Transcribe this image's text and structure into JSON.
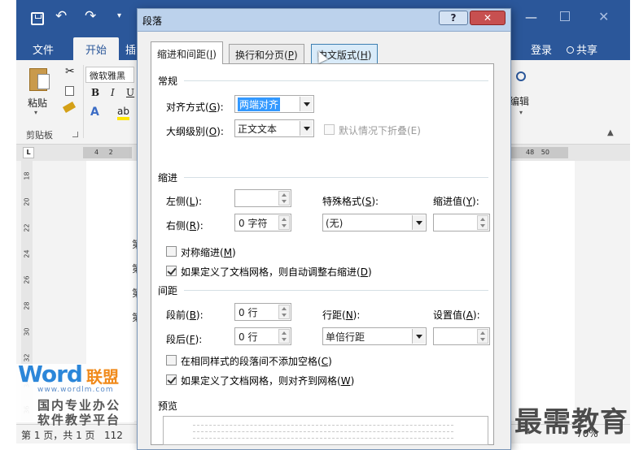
{
  "word": {
    "tabs": {
      "file": "文件",
      "home": "开始",
      "insert_partial": "插"
    },
    "account": {
      "login": "登录",
      "share": "共享"
    },
    "ribbon": {
      "paste_label": "粘贴",
      "clipboard_label": "剪贴板",
      "font_name": "微软雅黑",
      "bold": "B",
      "italic": "I",
      "underline": "U",
      "effects": "A",
      "highlight": "ab",
      "edit_label": "编辑"
    },
    "ruler": {
      "left_ticks": "4 2",
      "right_ticks": "48 50"
    },
    "vruler_ticks": [
      "18",
      "20",
      "22",
      "24",
      "26",
      "28",
      "30",
      "32",
      "34",
      "36"
    ],
    "doc_marks": [
      "第",
      "第",
      "第",
      "第"
    ],
    "status": {
      "page": "第 1 页，共 1 页",
      "page_extra": "112",
      "zoom": "70%"
    }
  },
  "watermark": {
    "word": "Word",
    "lianmeng": "联盟",
    "url": "www.wordlm.com",
    "line1": "国内专业办公",
    "line2": "软件教学平台",
    "brand": "最需教育"
  },
  "dialog": {
    "title": "段落",
    "help": "?",
    "close": "✕",
    "tabs": {
      "indent": {
        "text": "缩进和间距(",
        "key": "I",
        "end": ")"
      },
      "linebreak": {
        "text": "换行和分页(",
        "key": "P",
        "end": ")"
      },
      "asian": {
        "text": "中文版式(",
        "key": "H",
        "end": ")"
      }
    },
    "general": {
      "title": "常规",
      "alignment_label": {
        "text": "对齐方式(",
        "key": "G",
        "end": "):"
      },
      "alignment_value": "两端对齐",
      "outline_label": {
        "text": "大纲级别(",
        "key": "O",
        "end": "):"
      },
      "outline_value": "正文文本",
      "collapse_label": "默认情况下折叠(E)"
    },
    "indent": {
      "title": "缩进",
      "left_label": {
        "text": "左侧(",
        "key": "L",
        "end": "):"
      },
      "left_value": "",
      "right_label": {
        "text": "右侧(",
        "key": "R",
        "end": "):"
      },
      "right_value": "0 字符",
      "special_label": {
        "text": "特殊格式(",
        "key": "S",
        "end": "):"
      },
      "special_value": "(无)",
      "indent_by_label": {
        "text": "缩进值(",
        "key": "Y",
        "end": "):"
      },
      "indent_by_value": "",
      "mirror_label": {
        "text": "对称缩进(",
        "key": "M",
        "end": ")"
      },
      "mirror_checked": false,
      "auto_adjust_label": {
        "text": "如果定义了文档网格，则自动调整右缩进(",
        "key": "D",
        "end": ")"
      },
      "auto_adjust_checked": true
    },
    "spacing": {
      "title": "间距",
      "before_label": {
        "text": "段前(",
        "key": "B",
        "end": "):"
      },
      "before_value": "0 行",
      "after_label": {
        "text": "段后(",
        "key": "F",
        "end": "):"
      },
      "after_value": "0 行",
      "line_spacing_label": {
        "text": "行距(",
        "key": "N",
        "end": "):"
      },
      "line_spacing_value": "单倍行距",
      "at_label": {
        "text": "设置值(",
        "key": "A",
        "end": "):"
      },
      "at_value": "",
      "no_space_label": {
        "text": "在相同样式的段落间不添加空格(",
        "key": "C",
        "end": ")"
      },
      "no_space_checked": false,
      "snap_grid_label": {
        "text": "如果定义了文档网格，则对齐到网格(",
        "key": "W",
        "end": ")"
      },
      "snap_grid_checked": true
    },
    "preview": {
      "title": "预览"
    }
  }
}
